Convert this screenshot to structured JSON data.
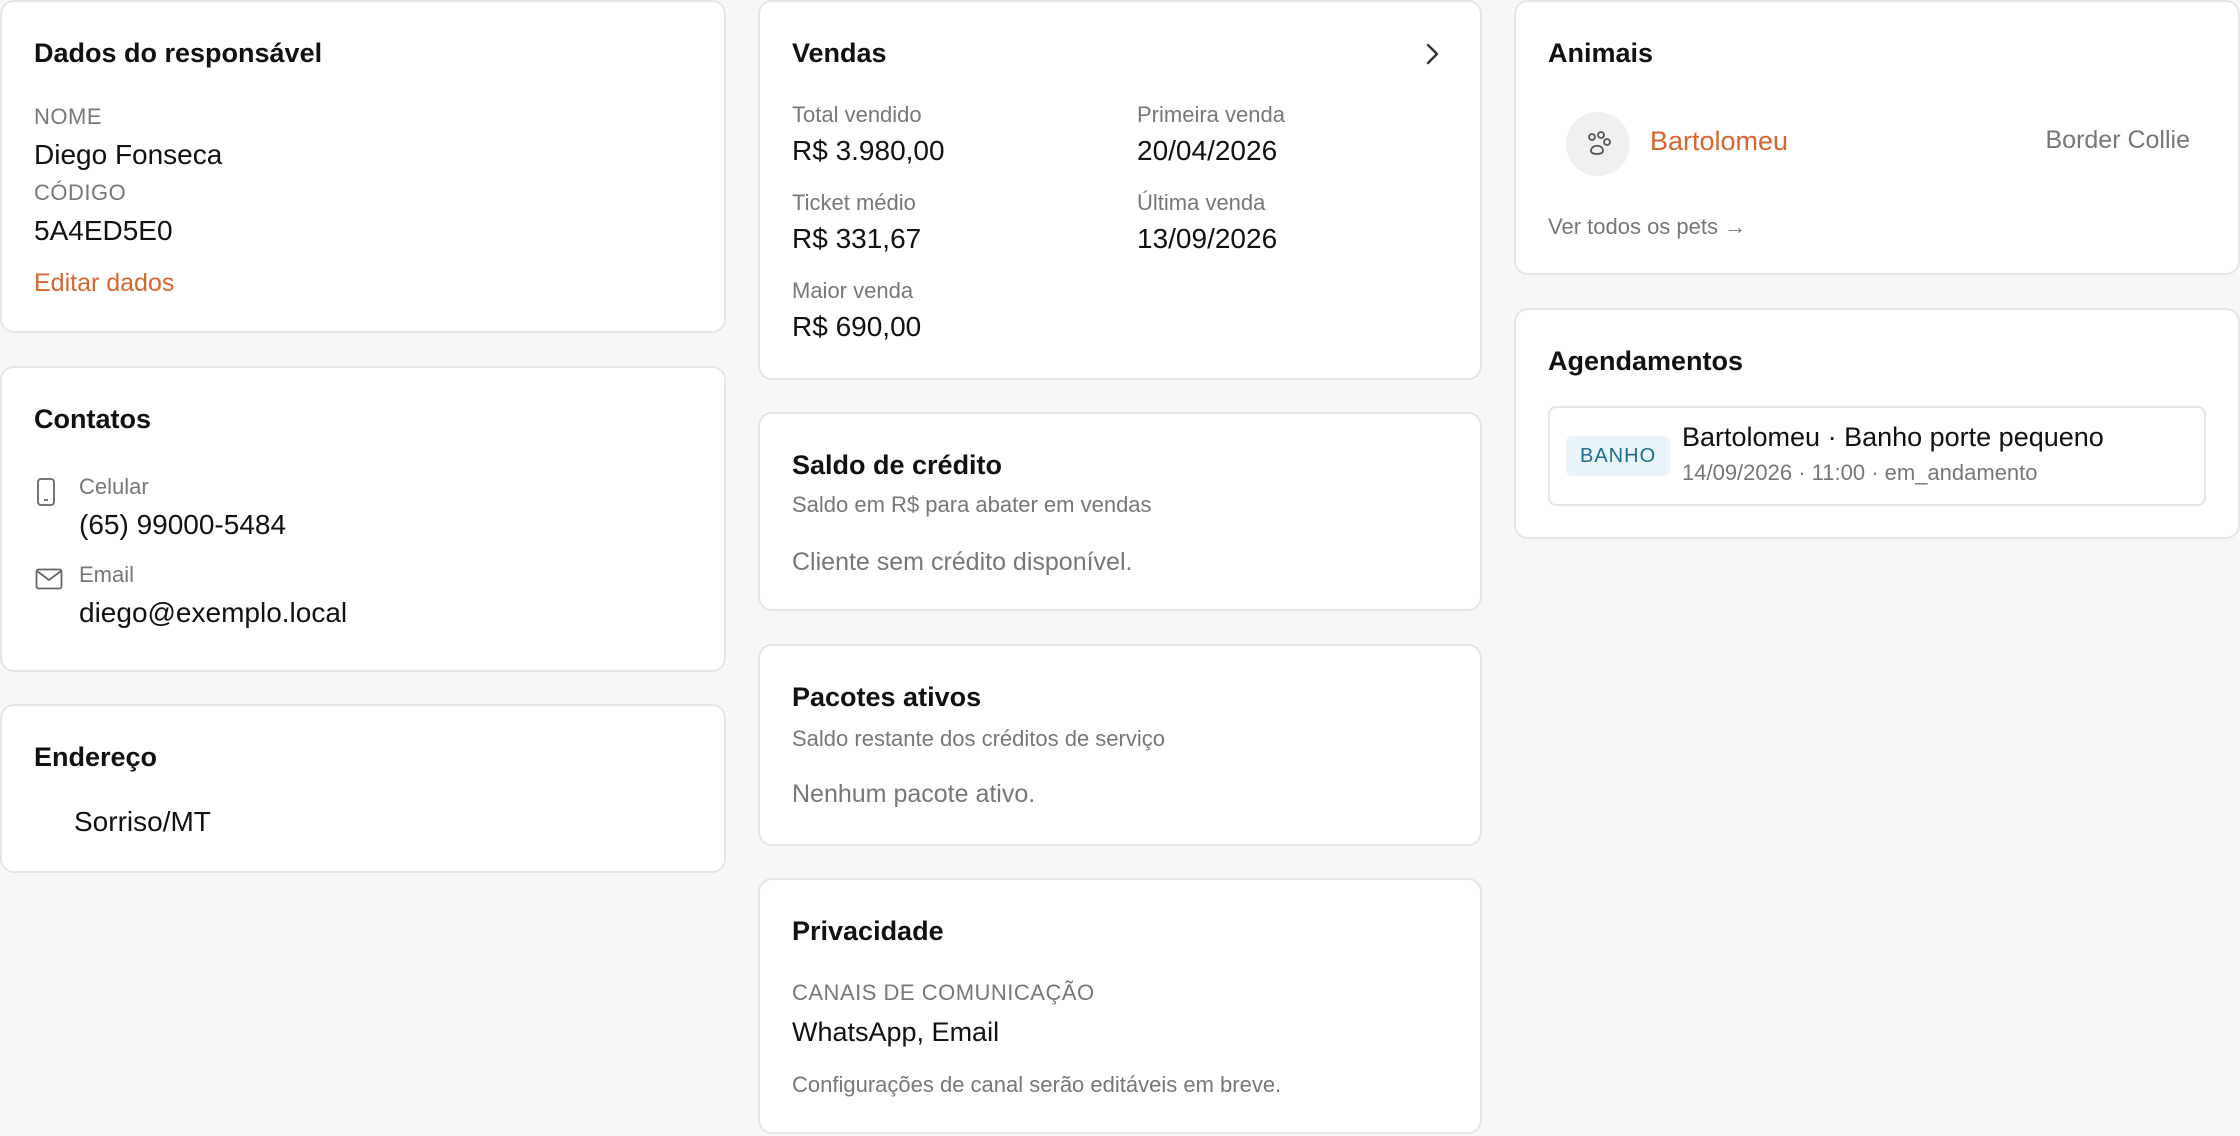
{
  "responsavel": {
    "title": "Dados do responsável",
    "nome_label": "NOME",
    "nome_value": "Diego Fonseca",
    "codigo_label": "CÓDIGO",
    "codigo_value": "5A4ED5E0",
    "edit_link": "Editar dados"
  },
  "contatos": {
    "title": "Contatos",
    "celular_label": "Celular",
    "celular_value": "(65) 99000-5484",
    "email_label": "Email",
    "email_value": "diego@exemplo.local"
  },
  "endereco": {
    "title": "Endereço",
    "value": "Sorriso/MT"
  },
  "vendas": {
    "title": "Vendas",
    "total_label": "Total vendido",
    "total_value": "R$ 3.980,00",
    "primeira_label": "Primeira venda",
    "primeira_value": "20/04/2026",
    "ticket_label": "Ticket médio",
    "ticket_value": "R$ 331,67",
    "ultima_label": "Última venda",
    "ultima_value": "13/09/2026",
    "maior_label": "Maior venda",
    "maior_value": "R$ 690,00"
  },
  "credito": {
    "title": "Saldo de crédito",
    "subtitle": "Saldo em R$ para abater em vendas",
    "empty": "Cliente sem crédito disponível."
  },
  "pacotes": {
    "title": "Pacotes ativos",
    "subtitle": "Saldo restante dos créditos de serviço",
    "empty": "Nenhum pacote ativo."
  },
  "privacidade": {
    "title": "Privacidade",
    "canais_label": "CANAIS DE COMUNICAÇÃO",
    "canais_value": "WhatsApp, Email",
    "note": "Configurações de canal serão editáveis em breve."
  },
  "animais": {
    "title": "Animais",
    "pets": [
      {
        "name": "Bartolomeu",
        "breed": "Border Collie"
      }
    ],
    "ver_todos": "Ver todos os pets →"
  },
  "agendamentos": {
    "title": "Agendamentos",
    "items": [
      {
        "badge": "BANHO",
        "title": "Bartolomeu · Banho porte pequeno",
        "meta": "14/09/2026 · 11:00 · em_andamento"
      }
    ]
  },
  "colors": {
    "accent": "#d9652e",
    "badge_bg": "#e8f4f8",
    "badge_text": "#1e6e8c"
  }
}
